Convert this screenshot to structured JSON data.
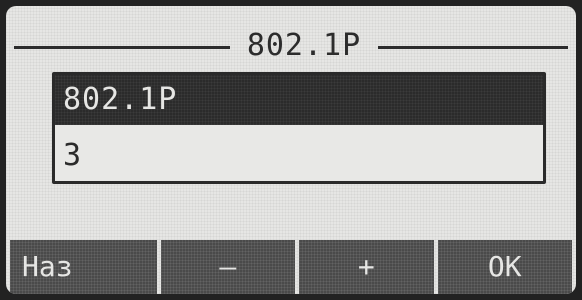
{
  "header": {
    "title": "802.1P"
  },
  "menu": {
    "items": [
      {
        "label": "802.1P",
        "selected": true
      },
      {
        "label": "3",
        "selected": false
      }
    ]
  },
  "softkeys": [
    {
      "label": "Наз"
    },
    {
      "label": "–"
    },
    {
      "label": "+"
    },
    {
      "label": "OK"
    }
  ],
  "colors": {
    "lcd_background": "#e6e6e4",
    "selection": "#2b2b2b",
    "softkey": "#4a4a4a"
  }
}
